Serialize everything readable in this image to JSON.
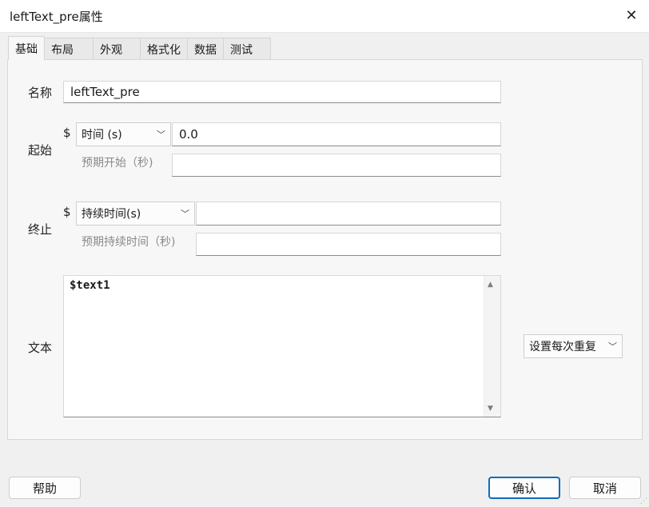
{
  "window": {
    "title": "leftText_pre属性"
  },
  "tabs": [
    "基础",
    "布局",
    "外观",
    "格式化",
    "数据",
    "测试"
  ],
  "fields": {
    "name": {
      "label": "名称",
      "value": "leftText_pre"
    },
    "start": {
      "label": "起始",
      "dollar": "$",
      "unit": "时间 (s)",
      "value": "0.0",
      "expected_label": "预期开始（秒)",
      "expected_value": ""
    },
    "stop": {
      "label": "终止",
      "dollar": "$",
      "unit": "持续时间(s)",
      "value": "",
      "expected_label": "预期持续时间（秒)",
      "expected_value": ""
    },
    "text": {
      "label": "文本",
      "value": "$text1",
      "repeat": "设置每次重复"
    }
  },
  "buttons": {
    "help": "帮助",
    "ok": "确认",
    "cancel": "取消"
  },
  "icons": {
    "close": "close-icon",
    "chevron": "chevron-down-icon",
    "scroll_up": "scroll-up-icon",
    "scroll_down": "scroll-down-icon"
  },
  "colors": {
    "accent": "#0f6cbd"
  }
}
